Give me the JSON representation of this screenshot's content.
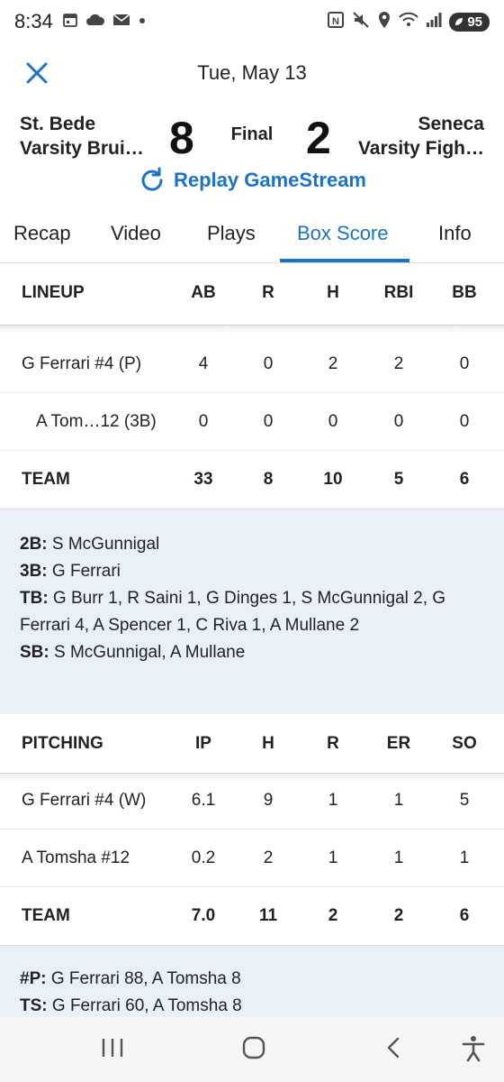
{
  "status_bar": {
    "time": "8:34",
    "battery": "95",
    "left_icons": [
      "calendar-icon",
      "cloud-icon",
      "mail-icon",
      "dot-icon"
    ],
    "right_icons": [
      "nfc-icon",
      "mute-icon",
      "location-icon",
      "wifi-icon",
      "signal-icon"
    ]
  },
  "header": {
    "date": "Tue, May 13",
    "home_team_line1": "St. Bede",
    "home_team_line2": "Varsity Brui…",
    "home_score": "8",
    "status": "Final",
    "away_score": "2",
    "away_team_line1": "Seneca",
    "away_team_line2": "Varsity Figh…",
    "replay_label": "Replay GameStream"
  },
  "tabs": [
    {
      "label": "Recap"
    },
    {
      "label": "Video"
    },
    {
      "label": "Plays"
    },
    {
      "label": "Box Score",
      "active": true
    },
    {
      "label": "Info"
    }
  ],
  "lineup": {
    "headers": [
      "LINEUP",
      "AB",
      "R",
      "H",
      "RBI",
      "BB"
    ],
    "rows": [
      [
        "G Ferrari #4 (P)",
        "4",
        "0",
        "2",
        "2",
        "0"
      ],
      [
        "A Tom…12 (3B)",
        "0",
        "0",
        "0",
        "0",
        "0"
      ]
    ],
    "team": [
      "TEAM",
      "33",
      "8",
      "10",
      "5",
      "6"
    ]
  },
  "batting_notes": [
    {
      "label": "2B:",
      "text": " S McGunnigal"
    },
    {
      "label": "3B:",
      "text": " G Ferrari"
    },
    {
      "label": "TB:",
      "text": " G Burr 1, R Saini 1, G Dinges 1, S McGunnigal 2, G Ferrari 4, A Spencer 1, C Riva 1, A Mullane 2"
    },
    {
      "label": "SB:",
      "text": " S McGunnigal, A Mullane"
    }
  ],
  "pitching": {
    "headers": [
      "PITCHING",
      "IP",
      "H",
      "R",
      "ER",
      "SO"
    ],
    "rows": [
      [
        "G Ferrari #4 (W)",
        "6.1",
        "9",
        "1",
        "1",
        "5"
      ],
      [
        "A Tomsha #12",
        "0.2",
        "2",
        "1",
        "1",
        "1"
      ]
    ],
    "team": [
      "TEAM",
      "7.0",
      "11",
      "2",
      "2",
      "6"
    ]
  },
  "pitching_notes": [
    {
      "label": "#P:",
      "text": " G Ferrari 88, A Tomsha 8"
    },
    {
      "label": "TS:",
      "text": " G Ferrari 60, A Tomsha 8"
    }
  ],
  "colors": {
    "accent": "#1a73c8",
    "notes_bg": "#eaf0f8"
  },
  "nav_bar": [
    "recents-icon",
    "home-icon",
    "back-icon",
    "accessibility-icon"
  ]
}
